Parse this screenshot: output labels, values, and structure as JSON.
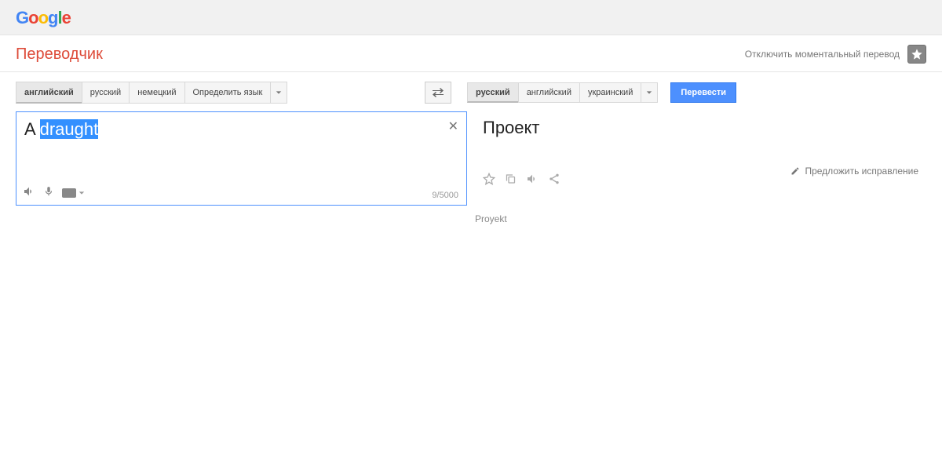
{
  "header": {
    "app_title": "Переводчик",
    "disable_instant": "Отключить моментальный перевод"
  },
  "source_langs": {
    "items": [
      "английский",
      "русский",
      "немецкий",
      "Определить язык"
    ],
    "active_index": 0
  },
  "target_langs": {
    "items": [
      "русский",
      "английский",
      "украинский"
    ],
    "active_index": 0
  },
  "translate_btn": "Перевести",
  "source": {
    "prefix": "A ",
    "highlighted": "draught",
    "char_count": "9/5000"
  },
  "target": {
    "text": "Проект",
    "transliteration": "Proyekt",
    "suggest_label": "Предложить исправление"
  }
}
